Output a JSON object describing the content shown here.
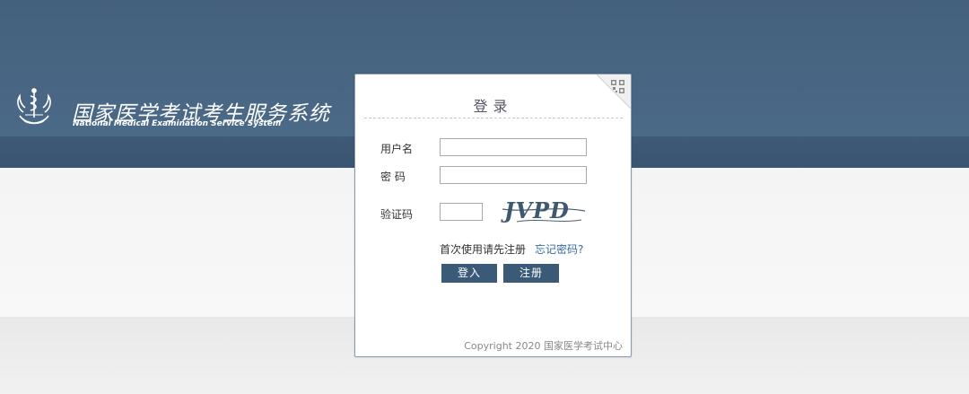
{
  "header": {
    "title": "国家医学考试考生服务系统",
    "subtitle": "National Medical Examination Service System"
  },
  "login": {
    "title": "登录",
    "username_label": "用户名",
    "password_label": "密 码",
    "captcha_label": "验证码",
    "username_value": "",
    "password_value": "",
    "captcha_value": "",
    "captcha_text": "JVPD",
    "register_prompt": "首次使用请先注册",
    "forgot_password": "忘记密码?",
    "login_button": "登入",
    "register_button": "注册",
    "copyright": "Copyright 2020 国家医学考试中心"
  },
  "colors": {
    "header_bg": "#4b6a88",
    "button_bg": "#3b5a78",
    "link": "#3a6aa0"
  },
  "icons": {
    "logo": "caduceus-emblem-icon",
    "corner": "qr-code-icon"
  }
}
